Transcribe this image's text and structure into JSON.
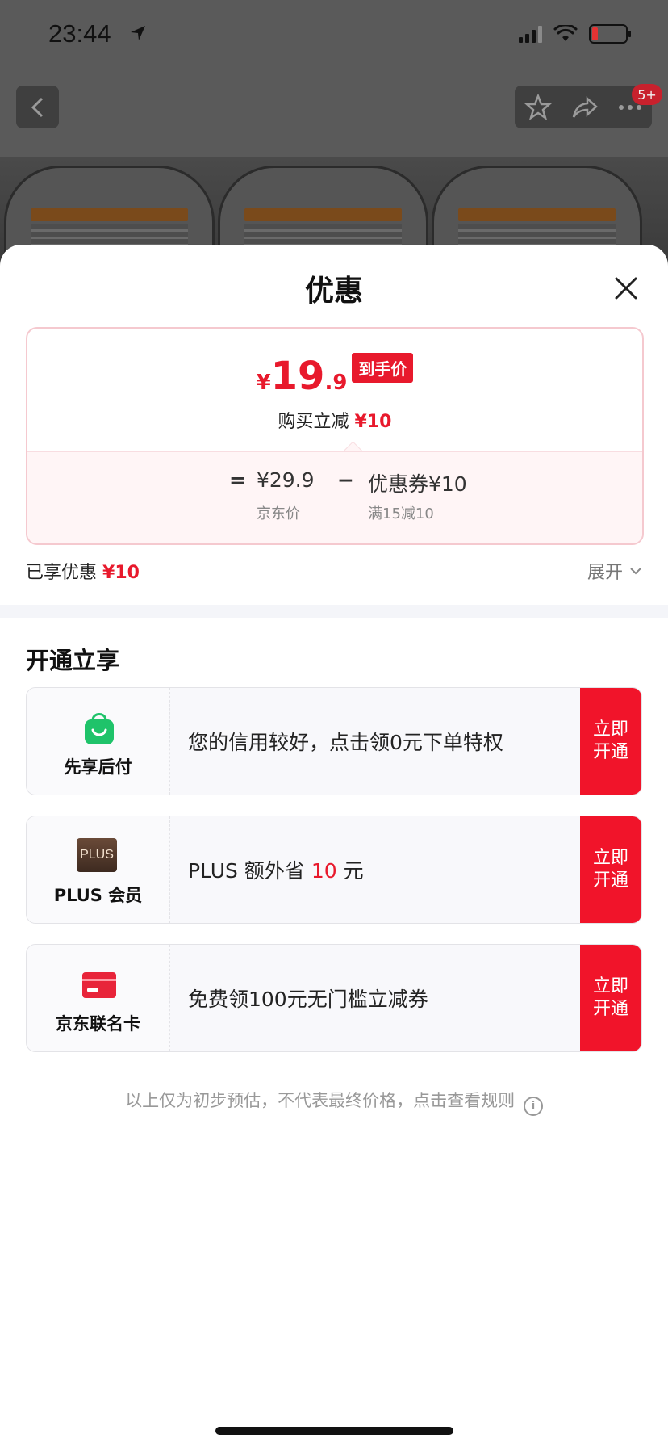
{
  "status_bar": {
    "time": "23:44"
  },
  "nav": {
    "badge": "5+"
  },
  "sheet": {
    "title": "优惠"
  },
  "price": {
    "yen": "¥",
    "int": "19",
    "dec": ".9",
    "tag": "到手价",
    "sub_label": "购买立减",
    "sub_amount": "¥10",
    "eq": "=",
    "jd_price": "¥29.9",
    "minus": "−",
    "coupon": "优惠券¥10",
    "jd_price_label": "京东价",
    "coupon_label": "满15减10"
  },
  "enjoyed": {
    "label": "已享优惠",
    "amount": "¥10",
    "expand": "展开"
  },
  "section_title": "开通立享",
  "offers": [
    {
      "name": "先享后付",
      "text": "您的信用较好，点击领0元下单特权",
      "btn": "立即开通",
      "icon": "shopping-bag-icon"
    },
    {
      "name": "PLUS 会员",
      "badge": "PLUS",
      "text_pre": "PLUS 额外省 ",
      "text_red": "10",
      "text_post": " 元",
      "btn": "立即开通",
      "icon": "plus-badge-icon"
    },
    {
      "name": "京东联名卡",
      "text": "免费领100元无门槛立减券",
      "btn": "立即开通",
      "icon": "card-icon"
    }
  ],
  "footnote": "以上仅为初步预估，不代表最终价格，点击查看规则",
  "colors": {
    "accent": "#e8192c",
    "green": "#1fc36a"
  }
}
